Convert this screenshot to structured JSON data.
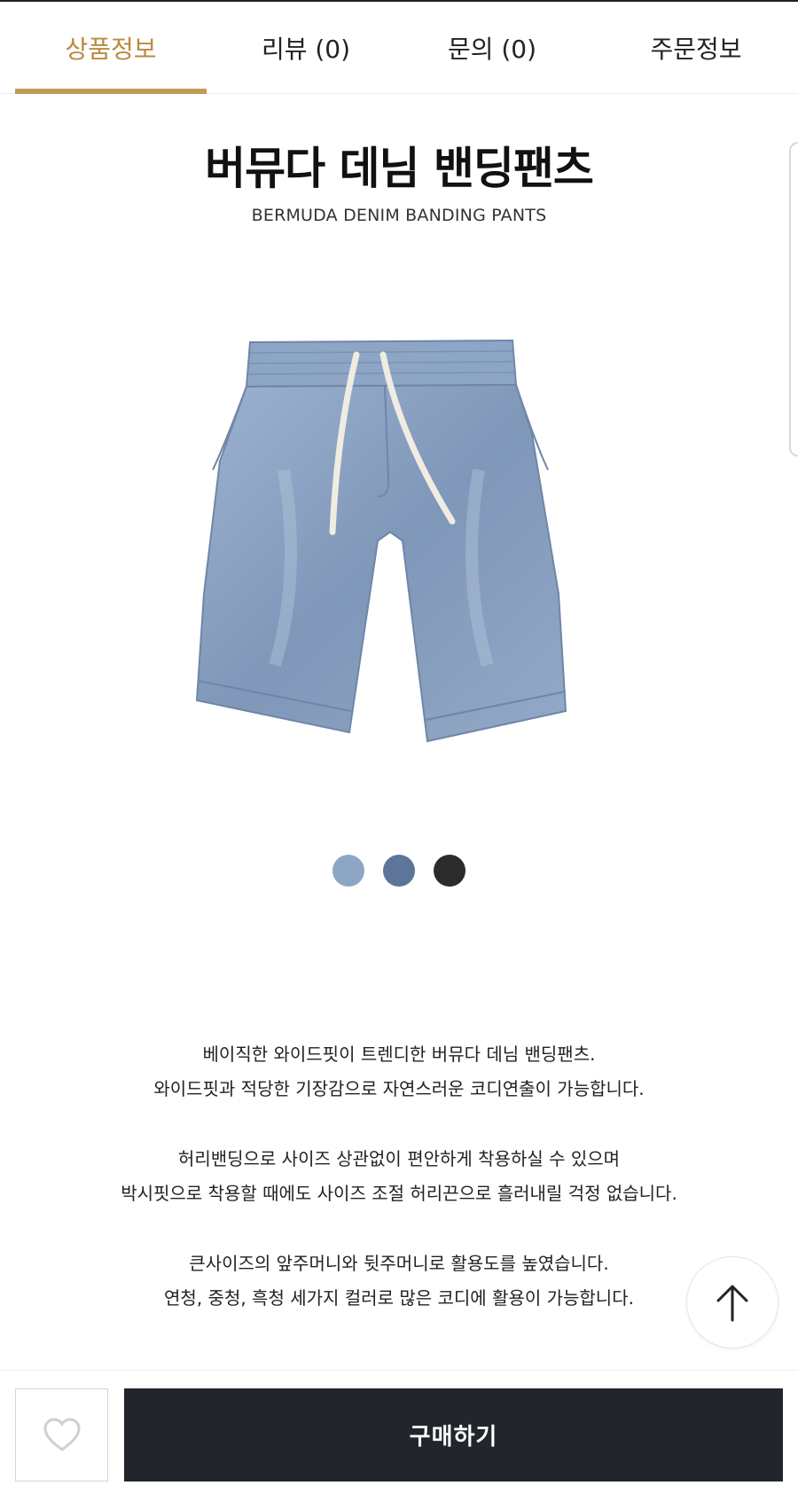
{
  "tabs": [
    {
      "label": "상품정보",
      "active": true
    },
    {
      "label": "리뷰 (0)",
      "active": false
    },
    {
      "label": "문의 (0)",
      "active": false
    },
    {
      "label": "주문정보",
      "active": false
    }
  ],
  "product": {
    "title": "버뮤다 데님 밴딩팬츠",
    "subtitle": "BERMUDA DENIM BANDING PANTS",
    "image_icon": "denim-shorts-image"
  },
  "colors": [
    {
      "name": "연청",
      "hex": "#8ea6c6"
    },
    {
      "name": "중청",
      "hex": "#5c7599"
    },
    {
      "name": "흑청",
      "hex": "#2b2b2b"
    }
  ],
  "description": [
    "베이직한 와이드핏이 트렌디한 버뮤다 데님 밴딩팬츠.",
    "와이드핏과 적당한 기장감으로 자연스러운 코디연출이 가능합니다.",
    "",
    "허리밴딩으로 사이즈 상관없이 편안하게 착용하실 수 있으며",
    "박시핏으로 착용할 때에도 사이즈 조절 허리끈으로 흘러내릴 걱정 없습니다.",
    "",
    "큰사이즈의 앞주머니와 뒷주머니로 활용도를 높였습니다.",
    "연청, 중청, 흑청 세가지 컬러로 많은 코디에 활용이 가능합니다."
  ],
  "actions": {
    "buy_label": "구매하기",
    "wishlist_icon": "heart-icon",
    "scroll_top_icon": "arrow-up-icon"
  },
  "accent_color": "#c39a55"
}
